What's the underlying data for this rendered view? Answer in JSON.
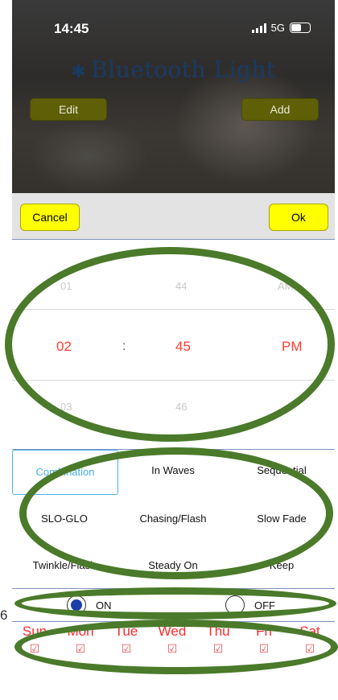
{
  "status": {
    "time": "14:45",
    "network": "5G"
  },
  "header": {
    "bt_symbol": "✱",
    "title": "Bluetooth Light",
    "edit_label": "Edit",
    "add_label": "Add"
  },
  "actions": {
    "cancel_label": "Cancel",
    "ok_label": "Ok"
  },
  "picker": {
    "hour_prev": "01",
    "minute_prev": "44",
    "ampm_prev": "AM",
    "hour": "02",
    "separator": ":",
    "minute": "45",
    "ampm": "PM",
    "hour_next": "03",
    "minute_next": "46"
  },
  "modes": [
    "Combination",
    "In Waves",
    "Sequential",
    "SLO-GLO",
    "Chasing/Flash",
    "Slow Fade",
    "Twinkle/Flash",
    "Steady On",
    "Keep"
  ],
  "selected_mode": "Combination",
  "power": {
    "on_label": "ON",
    "off_label": "OFF",
    "selected": "ON"
  },
  "days": [
    {
      "name": "Sun",
      "checked": true
    },
    {
      "name": "Mon",
      "checked": true
    },
    {
      "name": "Tue",
      "checked": true
    },
    {
      "name": "Wed",
      "checked": true
    },
    {
      "name": "Thu",
      "checked": true
    },
    {
      "name": "Fri",
      "checked": true
    },
    {
      "name": "Sat",
      "checked": true
    }
  ],
  "check_glyph": "☑",
  "stray_text": "6",
  "colors": {
    "accent_red": "#ff3b30",
    "button_yellow": "#ffff00",
    "selected_blue": "#4ab0e6",
    "annotation_green": "#4a7a2a"
  }
}
